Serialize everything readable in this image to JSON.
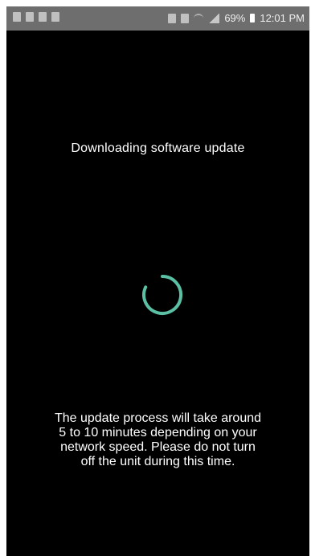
{
  "status_bar": {
    "battery_percent": "69%",
    "time": "12:01 PM",
    "icons": [
      "notification-icon",
      "notification-icon",
      "notification-icon",
      "notification-icon",
      "mute-icon",
      "alarm-icon",
      "wifi-icon",
      "signal-icon",
      "battery-icon"
    ]
  },
  "screen": {
    "title": "Downloading software update",
    "spinner_color": "#5bbfa4",
    "message_lines": [
      "The update process will take around",
      "5 to 10 minutes depending on your",
      "network speed. Please do not turn",
      "off the unit during this time."
    ]
  }
}
